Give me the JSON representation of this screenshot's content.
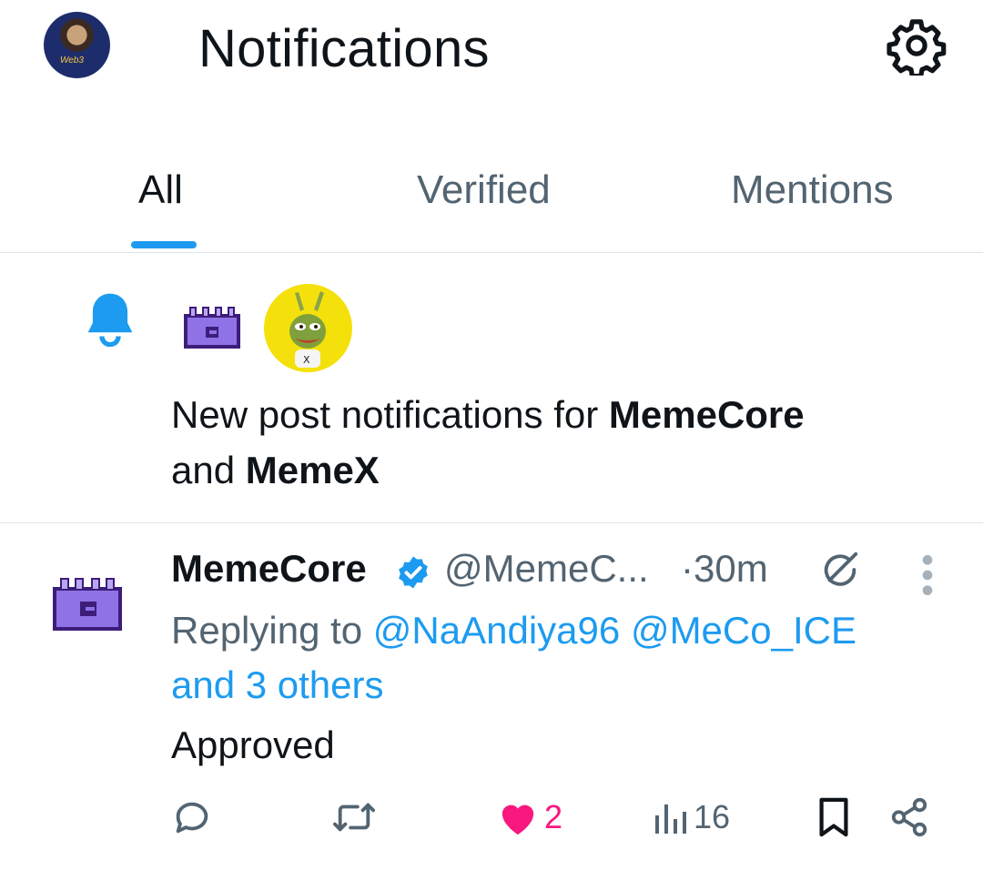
{
  "header": {
    "title": "Notifications",
    "avatar_tag": "Web3"
  },
  "tabs": [
    {
      "label": "All",
      "active": true
    },
    {
      "label": "Verified",
      "active": false
    },
    {
      "label": "Mentions",
      "active": false
    }
  ],
  "notification": {
    "text_prefix": "New post notifications for ",
    "account1": "MemeCore",
    "joiner": "and ",
    "account2": "MemeX"
  },
  "post": {
    "name": "MemeCore",
    "handle": "@MemeC...",
    "time": "·30m",
    "replying_prefix": "Replying to ",
    "mention1": "@NaAndiya96",
    "mention2": "@MeCo_ICE",
    "others": "and 3 others",
    "body": "Approved",
    "likes": "2",
    "views": "16"
  },
  "icons": {
    "settings": "gear-icon",
    "bell": "bell-icon",
    "verified": "verified-badge-icon",
    "grok": "grok-icon",
    "more": "more-vertical-icon",
    "reply": "reply-icon",
    "repost": "repost-icon",
    "like": "heart-icon",
    "views": "views-icon",
    "bookmark": "bookmark-icon",
    "share": "share-icon"
  },
  "colors": {
    "accent": "#1d9bf0",
    "like": "#f91880",
    "muted": "#536471",
    "text": "#0f1419",
    "memecore_purple": "#7b5ed6",
    "memex_yellow": "#f4e10b"
  }
}
